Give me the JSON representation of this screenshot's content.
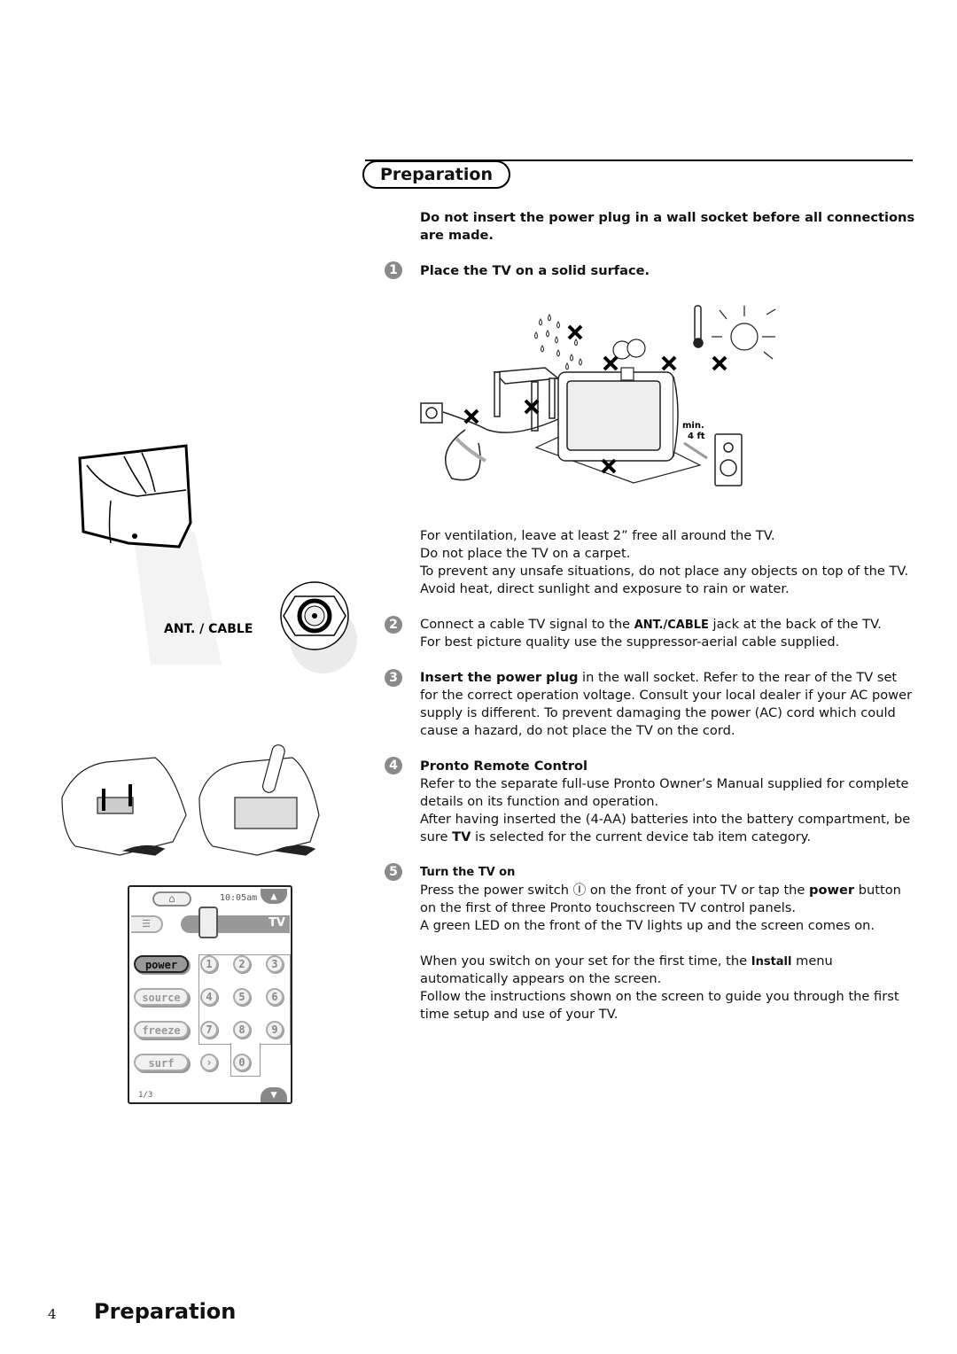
{
  "header": {
    "title": "Preparation"
  },
  "warning": "Do not insert the power plug in a wall socket before all connections are made.",
  "steps": [
    {
      "num": "1",
      "title": "Place the TV on a solid surface.",
      "lines": [
        "For ventilation, leave at least 2” free all around the TV.",
        "Do not place the TV on a carpet.",
        "To prevent any unsafe situations, do not place any objects on top of the TV.",
        "Avoid heat, direct sunlight and exposure to rain or water."
      ]
    },
    {
      "num": "2",
      "pre": "Connect a cable TV signal to the ",
      "bold": "ANT./CABLE",
      "post": " jack at the back of the TV.",
      "line2": "For best picture quality use the suppressor-aerial cable supplied."
    },
    {
      "num": "3",
      "bold": "Insert the power plug",
      "post": " in the wall socket. Refer to the rear of the TV set",
      "lines": [
        "for the correct operation voltage. Consult your local dealer if your AC power",
        "supply is different. To prevent damaging the power (AC) cord which could",
        "cause a hazard, do not place the TV on the cord."
      ]
    },
    {
      "num": "4",
      "title": "Pronto Remote Control",
      "lines": [
        "Refer to the separate full-use Pronto Owner’s Manual supplied for complete",
        "details on its function and operation.",
        "After having inserted the (4-AA) batteries into the battery compartment, be"
      ],
      "last_pre": "sure ",
      "last_bold": "TV",
      "last_post": " is selected for the current device tab item category."
    },
    {
      "num": "5",
      "title": "Turn the TV on",
      "l1_pre": "Press the power switch ",
      "l1_icon": "Ⓘ",
      "l1_mid": " on the front of your TV or tap the ",
      "l1_bold": "power",
      "l1_post": " button",
      "l2": "on the first of three Pronto touchscreen TV control panels.",
      "l3": "A green LED on the front of the TV lights up and the screen comes on.",
      "p2_pre": "When you switch on your set for the first time, the ",
      "p2_bold": "Install",
      "p2_post": " menu",
      "p2_l2": "automatically appears on the screen.",
      "p2_l3": "Follow the instructions shown on the screen to guide you through the first",
      "p2_l4": "time setup and use of your TV."
    }
  ],
  "illustration": {
    "speaker_distance_label": "min.",
    "speaker_distance_value": "4 ft"
  },
  "antenna": {
    "label": "ANT. / CABLE"
  },
  "remote": {
    "time": "10:05am",
    "device_tab": "TV",
    "buttons": [
      "power",
      "source",
      "freeze",
      "surf"
    ],
    "digits": [
      "1",
      "2",
      "3",
      "4",
      "5",
      "6",
      "7",
      "8",
      "9",
      "0"
    ],
    "page": "1/3"
  },
  "footer": {
    "page_number": "4",
    "title": "Preparation"
  }
}
